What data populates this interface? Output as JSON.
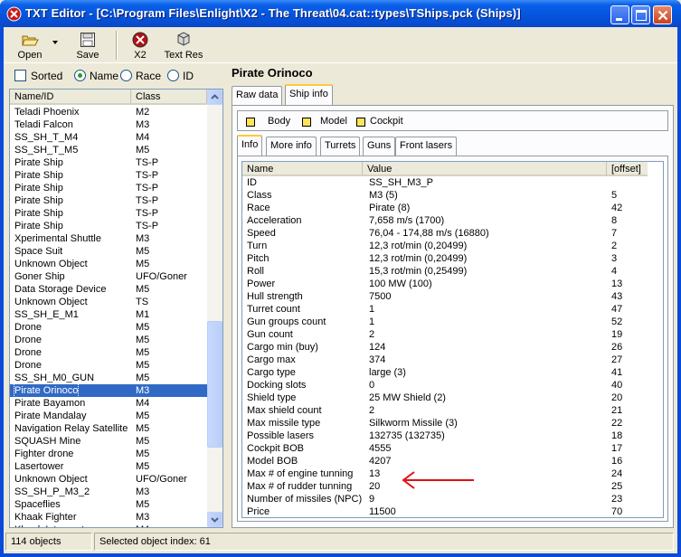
{
  "window": {
    "title": "TXT Editor - [C:\\Program Files\\Enlight\\X2 - The Threat\\04.cat::types\\TShips.pck (Ships)]"
  },
  "toolbar": {
    "open_label": "Open",
    "save_label": "Save",
    "x2_label": "X2",
    "textres_label": "Text Res"
  },
  "sort": {
    "sorted_label": "Sorted",
    "name_label": "Name",
    "race_label": "Race",
    "id_label": "ID",
    "sorted_checked": false,
    "selected_mode": "Name"
  },
  "object_list": {
    "headers": [
      "Name/ID",
      "Class"
    ],
    "rows": [
      [
        "Teladi Phoenix",
        "M2"
      ],
      [
        "Teladi Falcon",
        "M3"
      ],
      [
        "SS_SH_T_M4",
        "M4"
      ],
      [
        "SS_SH_T_M5",
        "M5"
      ],
      [
        "Pirate Ship",
        "TS-P"
      ],
      [
        "Pirate Ship",
        "TS-P"
      ],
      [
        "Pirate Ship",
        "TS-P"
      ],
      [
        "Pirate Ship",
        "TS-P"
      ],
      [
        "Pirate Ship",
        "TS-P"
      ],
      [
        "Pirate Ship",
        "TS-P"
      ],
      [
        "Xperimental Shuttle",
        "M3"
      ],
      [
        "Space Suit",
        "M5"
      ],
      [
        "Unknown Object",
        "M5"
      ],
      [
        "Goner Ship",
        "UFO/Goner"
      ],
      [
        "Data Storage Device",
        "M5"
      ],
      [
        "Unknown Object",
        "TS"
      ],
      [
        "SS_SH_E_M1",
        "M1"
      ],
      [
        "Drone",
        "M5"
      ],
      [
        "Drone",
        "M5"
      ],
      [
        "Drone",
        "M5"
      ],
      [
        "Drone",
        "M5"
      ],
      [
        "SS_SH_M0_GUN",
        "M5"
      ],
      [
        "Pirate Orinoco",
        "M3"
      ],
      [
        "Pirate Bayamon",
        "M4"
      ],
      [
        "Pirate Mandalay",
        "M5"
      ],
      [
        "Navigation Relay Satellite",
        "M5"
      ],
      [
        "SQUASH Mine",
        "M5"
      ],
      [
        "Fighter drone",
        "M5"
      ],
      [
        "Lasertower",
        "M5"
      ],
      [
        "Unknown Object",
        "UFO/Goner"
      ],
      [
        "SS_SH_P_M3_2",
        "M3"
      ],
      [
        "Spaceflies",
        "M5"
      ],
      [
        "Khaak Fighter",
        "M3"
      ],
      [
        "Khaak Interceptor",
        "M4"
      ]
    ],
    "selected_index": 22
  },
  "object_title": "Pirate Orinoco",
  "tabs": [
    "Raw data",
    "Ship info"
  ],
  "active_tab": "Ship info",
  "parts": [
    "Body",
    "Model",
    "Cockpit"
  ],
  "subtabs": [
    "Info",
    "More info",
    "Turrets",
    "Guns",
    "Front lasers"
  ],
  "active_subtab": "Info",
  "info_grid": {
    "headers": [
      "Name",
      "Value",
      "[offset]"
    ],
    "rows": [
      [
        "ID",
        "SS_SH_M3_P",
        ""
      ],
      [
        "Class",
        "M3 (5)",
        "5"
      ],
      [
        "Race",
        "Pirate (8)",
        "42"
      ],
      [
        "Acceleration",
        "7,658 m/s (1700)",
        "8"
      ],
      [
        "Speed",
        "76,04 - 174,88 m/s (16880)",
        "7"
      ],
      [
        "Turn",
        "12,3 rot/min (0,20499)",
        "2"
      ],
      [
        "Pitch",
        "12,3 rot/min (0,20499)",
        "3"
      ],
      [
        "Roll",
        "15,3 rot/min (0,25499)",
        "4"
      ],
      [
        "Power",
        "100 MW (100)",
        "13"
      ],
      [
        "Hull strength",
        "7500",
        "43"
      ],
      [
        "Turret count",
        "1",
        "47"
      ],
      [
        "Gun groups count",
        "1",
        "52"
      ],
      [
        "Gun count",
        "2",
        "19"
      ],
      [
        "Cargo min (buy)",
        "124",
        "26"
      ],
      [
        "Cargo max",
        "374",
        "27"
      ],
      [
        "Cargo type",
        "large (3)",
        "41"
      ],
      [
        "Docking slots",
        "0",
        "40"
      ],
      [
        "Shield type",
        "25 MW Shield (2)",
        "20"
      ],
      [
        "Max shield count",
        "2",
        "21"
      ],
      [
        "Max missile type",
        "Silkworm Missile (3)",
        "22"
      ],
      [
        "Possible lasers",
        "132735 (132735)",
        "18"
      ],
      [
        "Cockpit BOB",
        "4555",
        "17"
      ],
      [
        "Model BOB",
        "4207",
        "16"
      ],
      [
        "Max # of engine tunning",
        "13",
        "24"
      ],
      [
        "Max # of rudder tunning",
        "20",
        "25"
      ],
      [
        "Number of missiles (NPC)",
        "9",
        "23"
      ],
      [
        "Price",
        "11500",
        "70"
      ]
    ]
  },
  "status": {
    "count": "114 objects",
    "selected": "Selected object index: 61"
  },
  "colors": {
    "titlebar": "#0553dc",
    "selection": "#316ac5",
    "annotation_arrow": "#e01010",
    "active_tab_accent": "#ffc83c"
  }
}
